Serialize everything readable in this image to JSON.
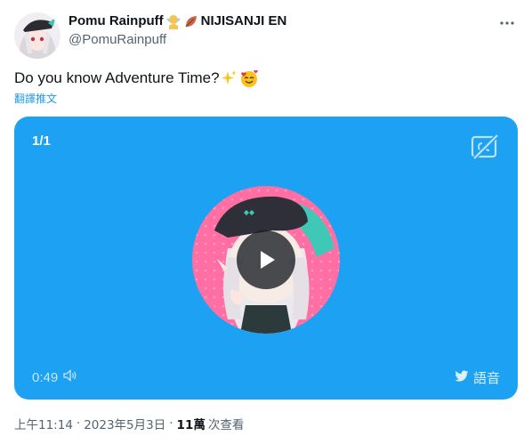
{
  "author": {
    "display_name": "Pomu Rainpuff",
    "affiliation": "NIJISANJI EN",
    "handle": "@PomuRainpuff"
  },
  "tweet": {
    "text": "Do you know Adventure Time?",
    "translate_label": "翻譯推文"
  },
  "media": {
    "counter": "1/1",
    "duration": "0:49",
    "audio_label": "語音"
  },
  "meta": {
    "time": "上午11:14",
    "date": "2023年5月3日",
    "views_count": "11萬",
    "views_label": "次查看",
    "separator": "·"
  },
  "icons": {
    "more": "more-horizontal-icon",
    "cc": "no-captions-icon",
    "play": "play-icon",
    "volume": "volume-icon",
    "bird": "twitter-bird-icon"
  },
  "colors": {
    "accent": "#1d9bf0",
    "media_bg": "#1da1f2",
    "secondary_text": "#536471",
    "primary_text": "#0f1419"
  }
}
